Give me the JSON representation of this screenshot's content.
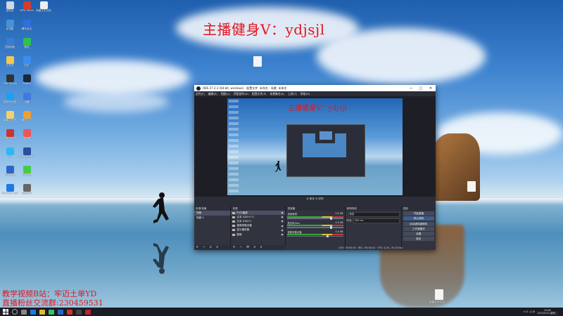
{
  "overlays": {
    "title": "主播健身V：ydjsjl",
    "bottom_line1": "教学视频B站：牢迈土单YD",
    "bottom_line2": "直播粉丝交流群:230459531"
  },
  "obs": {
    "title": "OBS 27.2.3 (64-bit, windows) - 配置文件: 未命名 - 场景: 未命名",
    "menu": [
      "文件(F)",
      "编辑(E)",
      "视图(V)",
      "停靠部件(D)",
      "配置文件(P)",
      "场景集合(S)",
      "工具(T)",
      "帮助(H)"
    ],
    "window_controls": [
      "—",
      "□",
      "✕"
    ],
    "nested_title": "主播健身V：ydjsjl",
    "toolbar_label": "⚙ 属性  ⚙ 滤镜",
    "scenes": {
      "header": "来源/场景",
      "items": [
        "场景",
        "场景 2"
      ],
      "footer": "+ − ∧ ∨"
    },
    "sources": {
      "header": "来源",
      "items": [
        {
          "name": "P2口播源"
        },
        {
          "name": "文本 (GDI+) 3"
        },
        {
          "name": "文本 (GDI+)"
        },
        {
          "name": "视频采集设备"
        },
        {
          "name": "显示器采集"
        },
        {
          "name": "图像"
        }
      ],
      "footer": "+ − ⚙ ∧ ∨"
    },
    "mixer": {
      "header": "混音器",
      "channels": [
        {
          "label": "桌面音频",
          "db": "0.0 dB",
          "level": 0.78
        },
        {
          "label": "麦克风/Aux",
          "db": "0.0 dB",
          "level": 0.78
        },
        {
          "label": "视频采集设备",
          "db": "0.0 dB",
          "level": 0.72
        }
      ]
    },
    "transitions": {
      "header": "转场特效",
      "type": "渐变",
      "duration_label": "时长",
      "duration_value": "300 ms"
    },
    "controls": {
      "header": "控制",
      "buttons": [
        "开始直播",
        "停止录制",
        "启动虚拟摄像机",
        "工作室模式",
        "设置",
        "退出"
      ]
    },
    "status": {
      "live": "LIVE: 00:00:00",
      "rec": "REC: 00:08:42",
      "cpu": "CPU: 4.2%, 30.00 fps"
    }
  },
  "desktop": {
    "icon_labels": [
      "",
      "回收站",
      "此电脑",
      "控制面板",
      "文件夹",
      "OBS Studio",
      "剪映专业版",
      "新建文件夹",
      "网易云音乐",
      "QQ",
      "百度网盘",
      "Microsoft Edge",
      "WPS Office",
      "腾讯会议",
      "微信",
      "钉钉",
      "Steam",
      "迅雷",
      "格式工厂",
      "爱剪辑",
      "Photoshop",
      "EV录屏",
      "录屏软件",
      "新建文本文档"
    ],
    "loose_file_label": "新建文本文档"
  },
  "taskbar": {
    "time": "19:08",
    "date": "2022/5/10 星期二",
    "tray_text": "∧ ⊡ ◁) 中"
  },
  "colors": {
    "overlay_red": "#e8141c",
    "obs_bg": "#2b2e38",
    "taskbar_bg": "#1a1d24"
  }
}
